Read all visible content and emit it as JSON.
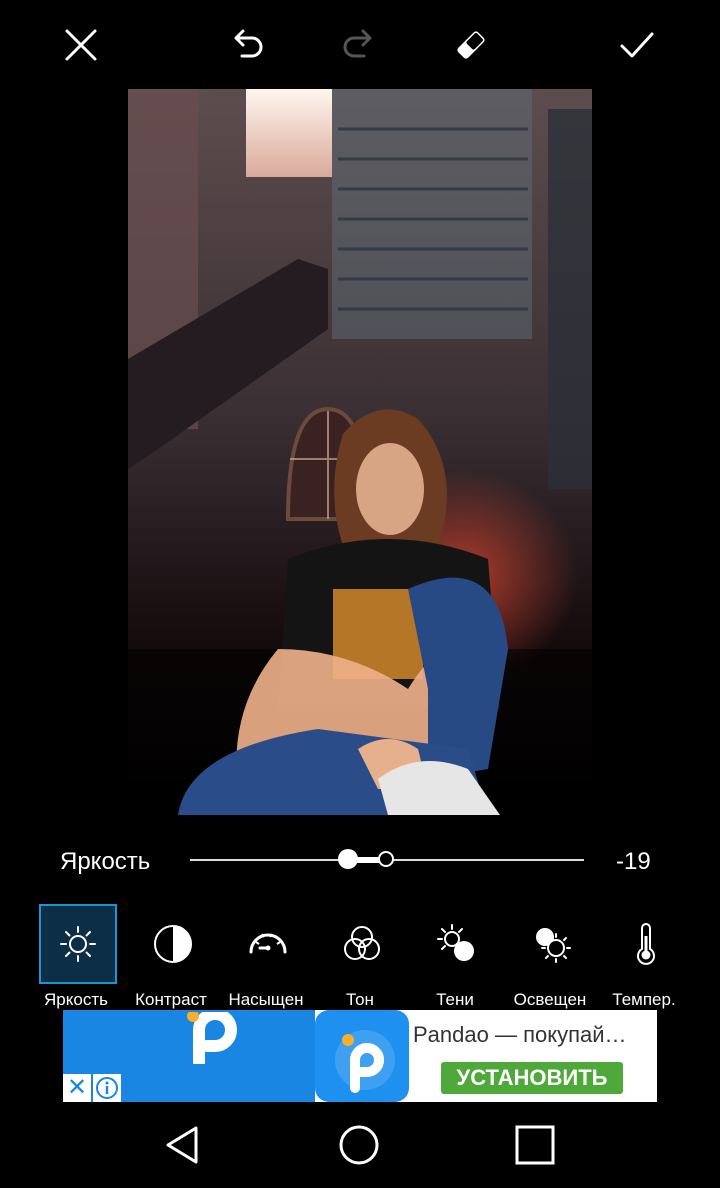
{
  "toolbar": {
    "close": {
      "icon": "close-icon"
    },
    "undo": {
      "icon": "undo-icon"
    },
    "redo": {
      "icon": "redo-icon",
      "state": "disabled"
    },
    "eraser": {
      "icon": "eraser-icon"
    },
    "apply": {
      "icon": "check-icon"
    }
  },
  "slider": {
    "label": "Яркость",
    "value": "-19",
    "min": -100,
    "max": 100,
    "current": -19
  },
  "tools": [
    {
      "label": "Яркость",
      "icon": "brightness-icon",
      "selected": true
    },
    {
      "label": "Контраст",
      "icon": "contrast-icon",
      "selected": false
    },
    {
      "label": "Насыщен",
      "icon": "saturation-icon",
      "selected": false
    },
    {
      "label": "Тон",
      "icon": "hue-icon",
      "selected": false
    },
    {
      "label": "Тени",
      "icon": "shadows-icon",
      "selected": false
    },
    {
      "label": "Освещен",
      "icon": "highlights-icon",
      "selected": false
    },
    {
      "label": "Темпер.",
      "icon": "temperature-icon",
      "selected": false
    }
  ],
  "ad": {
    "title": "Pandao — покупай…",
    "cta": "УСТАНОВИТЬ",
    "close_icon": "close-icon",
    "info_icon": "info-icon"
  },
  "colors": {
    "accent": "#1f93d6",
    "selected_tile": "#0c2f46",
    "ad_blue": "#1a86e3",
    "cta_green": "#4ea83a"
  },
  "navbar": {
    "back": {
      "icon": "back-icon"
    },
    "home": {
      "icon": "home-icon"
    },
    "recent": {
      "icon": "recent-apps-icon"
    }
  }
}
